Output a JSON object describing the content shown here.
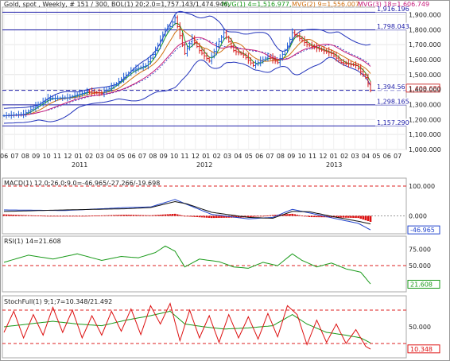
{
  "header": {
    "symbol": "Gold, spot , Weekly, # 151 / 300, BOL(1) 20;2.0=1,757.143/1,474.946,",
    "mvg1": "MVG(1) 4=1,516.977,",
    "mvg2": "MVG(2) 9=1,556.007,",
    "mvg3": "MVG(3) 18=1,606.749"
  },
  "colors": {
    "price_up": "#1f5fd6",
    "price_down": "#d81e1e",
    "boll": "#2233bb",
    "mvg1": "#1a9a1a",
    "mvg2": "#d07010",
    "mvg3": "#c61a7a",
    "hline": "#2222aa",
    "macd": "#2244cc",
    "signal": "#111111",
    "hist": "#dd1111",
    "rsi": "#1a9a1a",
    "stoch_k": "#dd1111",
    "stoch_d": "#1a9a1a",
    "dashed": "#dd2222"
  },
  "price_panel": {
    "levels": [
      "1,916.196",
      "1,798.043",
      "1,394.567",
      "1,298.165",
      "1,157.290"
    ],
    "current_label": "1,409.680",
    "yticks": [
      "1,900.000",
      "1,800.000",
      "1,700.000",
      "1,600.000",
      "1,500.000",
      "1,400.000",
      "1,300.000",
      "1,200.000",
      "1,100.000",
      "1,000.000"
    ],
    "xticks_months": [
      "06",
      "07",
      "08",
      "09",
      "10",
      "11",
      "12",
      "01",
      "02",
      "03",
      "04",
      "05",
      "06",
      "07",
      "08",
      "09",
      "10",
      "11",
      "12",
      "01",
      "02",
      "03",
      "04",
      "05",
      "06",
      "07",
      "08",
      "09",
      "10",
      "11",
      "12",
      "01",
      "02",
      "03",
      "04",
      "05",
      "06",
      "07"
    ],
    "xticks_years": [
      "2011",
      "2012",
      "2013"
    ]
  },
  "macd_panel": {
    "label": "MACD(1) 12.0;26.0;9.0=-46.965/-27.266/-19.698",
    "yticks": [
      "100.000",
      "0.000"
    ],
    "current_label": "-46.965"
  },
  "rsi_panel": {
    "label": "RSI(1) 14=21.608",
    "yticks": [
      "75.000",
      "50.000"
    ],
    "current_label": "21.608"
  },
  "stoch_panel": {
    "label": "StochFull(1) 9;1;7=10.348/21.492",
    "yticks": [
      "50.000"
    ],
    "current_label": "10.348"
  },
  "chart_data": {
    "type": "line",
    "ylim": [
      1000,
      1950
    ],
    "anchors_close": [
      [
        0,
        1225
      ],
      [
        8,
        1235
      ],
      [
        18,
        1340
      ],
      [
        26,
        1345
      ],
      [
        34,
        1385
      ],
      [
        40,
        1375
      ],
      [
        46,
        1440
      ],
      [
        52,
        1525
      ],
      [
        58,
        1560
      ],
      [
        62,
        1660
      ],
      [
        66,
        1800
      ],
      [
        68,
        1820
      ],
      [
        70,
        1880
      ],
      [
        72,
        1760
      ],
      [
        74,
        1640
      ],
      [
        77,
        1740
      ],
      [
        80,
        1660
      ],
      [
        84,
        1590
      ],
      [
        88,
        1720
      ],
      [
        90,
        1780
      ],
      [
        94,
        1660
      ],
      [
        98,
        1630
      ],
      [
        102,
        1560
      ],
      [
        108,
        1620
      ],
      [
        112,
        1580
      ],
      [
        116,
        1690
      ],
      [
        118,
        1780
      ],
      [
        120,
        1755
      ],
      [
        124,
        1700
      ],
      [
        128,
        1675
      ],
      [
        134,
        1640
      ],
      [
        138,
        1580
      ],
      [
        144,
        1560
      ],
      [
        148,
        1480
      ],
      [
        150,
        1395
      ]
    ],
    "anchors_macd": [
      [
        0,
        20
      ],
      [
        25,
        18
      ],
      [
        50,
        28
      ],
      [
        60,
        30
      ],
      [
        70,
        55
      ],
      [
        75,
        38
      ],
      [
        85,
        5
      ],
      [
        100,
        -10
      ],
      [
        110,
        -5
      ],
      [
        118,
        22
      ],
      [
        125,
        10
      ],
      [
        135,
        -8
      ],
      [
        145,
        -25
      ],
      [
        150,
        -47
      ]
    ],
    "anchors_signal": [
      [
        0,
        15
      ],
      [
        25,
        20
      ],
      [
        50,
        24
      ],
      [
        60,
        28
      ],
      [
        70,
        48
      ],
      [
        75,
        40
      ],
      [
        85,
        12
      ],
      [
        100,
        -5
      ],
      [
        110,
        -8
      ],
      [
        118,
        15
      ],
      [
        125,
        14
      ],
      [
        135,
        -3
      ],
      [
        145,
        -18
      ],
      [
        150,
        -27
      ]
    ],
    "anchors_rsi": [
      [
        0,
        55
      ],
      [
        10,
        66
      ],
      [
        20,
        60
      ],
      [
        30,
        68
      ],
      [
        40,
        58
      ],
      [
        48,
        64
      ],
      [
        55,
        62
      ],
      [
        62,
        70
      ],
      [
        66,
        80
      ],
      [
        70,
        72
      ],
      [
        74,
        48
      ],
      [
        80,
        60
      ],
      [
        88,
        56
      ],
      [
        94,
        48
      ],
      [
        100,
        46
      ],
      [
        106,
        55
      ],
      [
        112,
        50
      ],
      [
        118,
        68
      ],
      [
        122,
        58
      ],
      [
        128,
        48
      ],
      [
        134,
        54
      ],
      [
        140,
        45
      ],
      [
        146,
        40
      ],
      [
        150,
        22
      ]
    ],
    "anchors_stoch_k": [
      [
        0,
        40
      ],
      [
        4,
        78
      ],
      [
        8,
        30
      ],
      [
        12,
        72
      ],
      [
        16,
        35
      ],
      [
        20,
        85
      ],
      [
        24,
        40
      ],
      [
        28,
        80
      ],
      [
        32,
        30
      ],
      [
        36,
        70
      ],
      [
        40,
        35
      ],
      [
        44,
        78
      ],
      [
        48,
        42
      ],
      [
        52,
        82
      ],
      [
        56,
        36
      ],
      [
        60,
        88
      ],
      [
        64,
        55
      ],
      [
        68,
        92
      ],
      [
        72,
        25
      ],
      [
        76,
        80
      ],
      [
        80,
        30
      ],
      [
        84,
        70
      ],
      [
        88,
        22
      ],
      [
        92,
        72
      ],
      [
        96,
        30
      ],
      [
        100,
        68
      ],
      [
        104,
        28
      ],
      [
        108,
        74
      ],
      [
        112,
        32
      ],
      [
        116,
        88
      ],
      [
        120,
        72
      ],
      [
        124,
        18
      ],
      [
        128,
        62
      ],
      [
        132,
        22
      ],
      [
        136,
        55
      ],
      [
        140,
        20
      ],
      [
        144,
        45
      ],
      [
        148,
        15
      ],
      [
        150,
        10
      ]
    ],
    "anchors_stoch_d": [
      [
        0,
        50
      ],
      [
        10,
        55
      ],
      [
        20,
        60
      ],
      [
        30,
        55
      ],
      [
        40,
        52
      ],
      [
        50,
        62
      ],
      [
        60,
        70
      ],
      [
        68,
        78
      ],
      [
        74,
        55
      ],
      [
        82,
        50
      ],
      [
        90,
        46
      ],
      [
        100,
        48
      ],
      [
        110,
        52
      ],
      [
        118,
        72
      ],
      [
        124,
        55
      ],
      [
        132,
        40
      ],
      [
        140,
        35
      ],
      [
        146,
        30
      ],
      [
        150,
        21
      ]
    ]
  }
}
